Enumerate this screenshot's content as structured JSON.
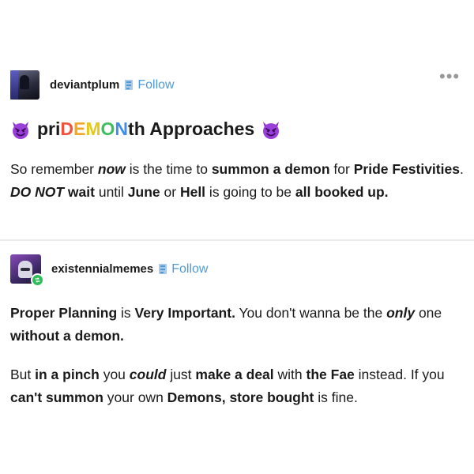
{
  "post1": {
    "username": "deviantplum",
    "follow_label": "Follow",
    "more_label": "•••",
    "title_parts": {
      "pri": "pri",
      "d": "D",
      "e": "E",
      "m": "M",
      "o": "O",
      "n": "N",
      "th": "th",
      "rest": " Approaches"
    },
    "body": [
      {
        "t": "So remember ",
        "s": "n"
      },
      {
        "t": "now",
        "s": "bi"
      },
      {
        "t": " is the time to ",
        "s": "n"
      },
      {
        "t": "summon a demon",
        "s": "b"
      },
      {
        "t": " for ",
        "s": "n"
      },
      {
        "t": "Pride Festivities",
        "s": "b"
      },
      {
        "t": ". ",
        "s": "n"
      },
      {
        "t": "DO NOT",
        "s": "bi"
      },
      {
        "t": " wait",
        "s": "b"
      },
      {
        "t": " until ",
        "s": "n"
      },
      {
        "t": "June",
        "s": "b"
      },
      {
        "t": " or ",
        "s": "n"
      },
      {
        "t": "Hell",
        "s": "b"
      },
      {
        "t": " is going to be ",
        "s": "n"
      },
      {
        "t": "all booked up.",
        "s": "b"
      }
    ]
  },
  "post2": {
    "username": "existennialmemes",
    "follow_label": "Follow",
    "para1": [
      {
        "t": "Proper Planning",
        "s": "b"
      },
      {
        "t": " is ",
        "s": "n"
      },
      {
        "t": "Very Important.",
        "s": "b"
      },
      {
        "t": " You don't wanna be the ",
        "s": "n"
      },
      {
        "t": "only",
        "s": "bi"
      },
      {
        "t": " one ",
        "s": "n"
      },
      {
        "t": "without a demon.",
        "s": "b"
      }
    ],
    "para2": [
      {
        "t": "But ",
        "s": "n"
      },
      {
        "t": "in a pinch",
        "s": "b"
      },
      {
        "t": " you ",
        "s": "n"
      },
      {
        "t": "could",
        "s": "bi"
      },
      {
        "t": " just ",
        "s": "n"
      },
      {
        "t": "make a deal",
        "s": "b"
      },
      {
        "t": " with ",
        "s": "n"
      },
      {
        "t": "the Fae",
        "s": "b"
      },
      {
        "t": " instead. If you ",
        "s": "n"
      },
      {
        "t": "can't summon",
        "s": "b"
      },
      {
        "t": " your own ",
        "s": "n"
      },
      {
        "t": "Demons, store bought",
        "s": "b"
      },
      {
        "t": " is fine.",
        "s": "n"
      }
    ]
  },
  "icons": {
    "follow": "follow-icon",
    "demon": "smiling-face-with-horns-icon",
    "reblog": "reblog-icon",
    "more": "more-options-icon"
  },
  "colors": {
    "follow_blue": "#4e9ad8",
    "demon_purple": "#9a3fd8",
    "reblog_green": "#2fbd5a"
  }
}
